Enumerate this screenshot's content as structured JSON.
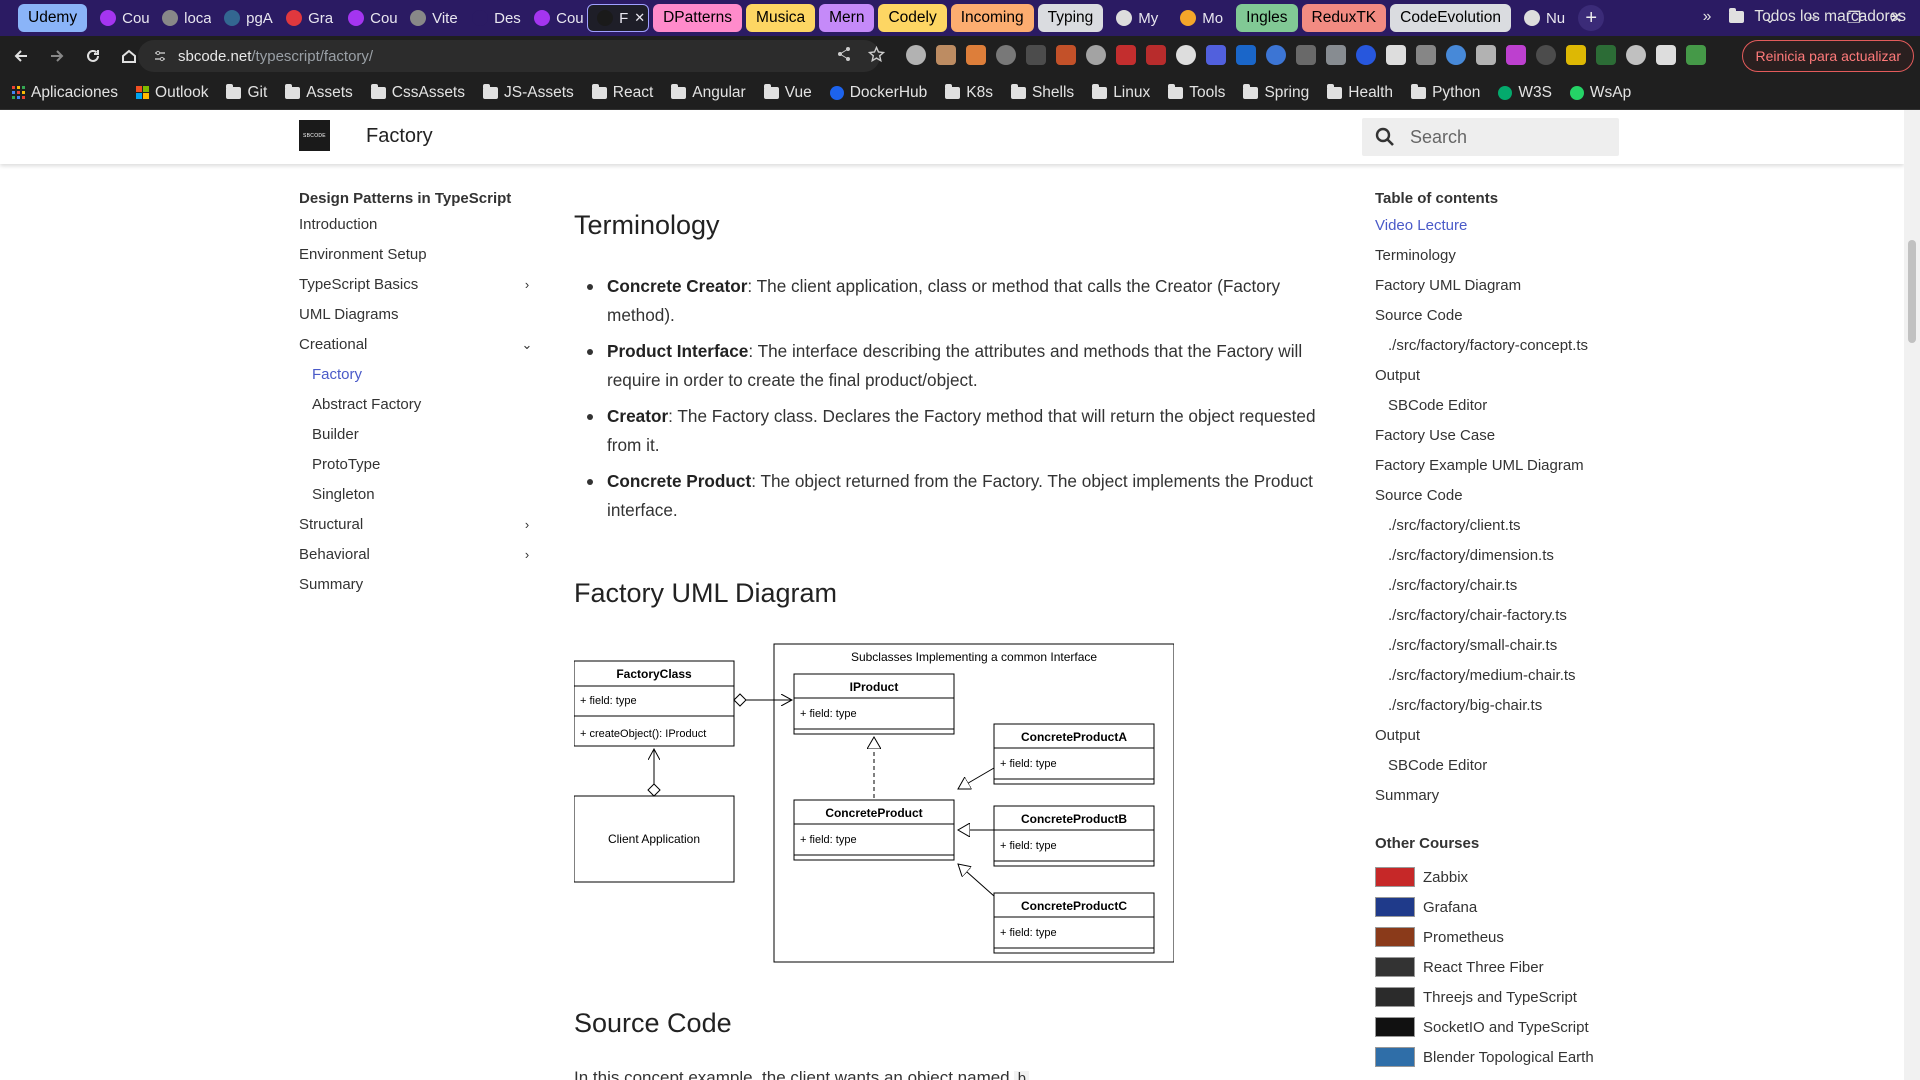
{
  "tabs": [
    {
      "label": "Udemy",
      "type": "group",
      "color": "#8ab4f8"
    },
    {
      "label": "Cou",
      "type": "plain",
      "icon": "udemy-icon",
      "favcolor": "#a435f0"
    },
    {
      "label": "loca",
      "type": "plain",
      "icon": "localhost-icon",
      "favcolor": "#888888"
    },
    {
      "label": "pgA",
      "type": "plain",
      "icon": "pgadmin-icon",
      "favcolor": "#336791"
    },
    {
      "label": "Gra",
      "type": "plain",
      "icon": "grafana-icon",
      "favcolor": "#e0383e"
    },
    {
      "label": "Cou",
      "type": "plain",
      "icon": "udemy-icon",
      "favcolor": "#a435f0"
    },
    {
      "label": "Vite",
      "type": "plain",
      "icon": "vite-icon",
      "favcolor": "#888888"
    },
    {
      "label": "Des",
      "type": "plain",
      "icon": "design-icon",
      "favcolor": "#2b1b63"
    },
    {
      "label": "Cou",
      "type": "plain",
      "icon": "udemy-icon",
      "favcolor": "#a435f0"
    },
    {
      "label": "F",
      "type": "active",
      "icon": "sbcode-icon",
      "favcolor": "#1a1a1a"
    },
    {
      "label": "DPatterns",
      "type": "group",
      "color": "#ff8bcb"
    },
    {
      "label": "Musica",
      "type": "group",
      "color": "#fdd663"
    },
    {
      "label": "Mern",
      "type": "group",
      "color": "#c58af9"
    },
    {
      "label": "Codely",
      "type": "group",
      "color": "#fdd663"
    },
    {
      "label": "Incoming",
      "type": "group",
      "color": "#fcad70"
    },
    {
      "label": "Typing",
      "type": "group",
      "color": "#dadce0"
    },
    {
      "label": "My",
      "type": "chip",
      "icon": "doc-icon",
      "favcolor": "#dddddd"
    },
    {
      "label": "Mo",
      "type": "chip",
      "icon": "mt-icon",
      "favcolor": "#f4a62a"
    },
    {
      "label": "Ingles",
      "type": "group",
      "color": "#81c995"
    },
    {
      "label": "ReduxTK",
      "type": "group",
      "color": "#f28b82"
    },
    {
      "label": "CodeEvolution",
      "type": "group",
      "color": "#dadce0"
    },
    {
      "label": "Nu",
      "type": "chip",
      "icon": "globe-icon",
      "favcolor": "#dddddd"
    }
  ],
  "window": {
    "newtab": "+",
    "minimize": "–",
    "maximize": "❐",
    "close": "✕",
    "tablist": "⌄"
  },
  "address": {
    "host": "sbcode.net",
    "path": "/typescript/factory/",
    "update_label": "Reinicia para actualizar"
  },
  "bookmarks": [
    {
      "label": "Aplicaciones",
      "icon": "apps-grid-icon"
    },
    {
      "label": "Outlook",
      "icon": "microsoft-icon"
    },
    {
      "label": "Git",
      "icon": "folder-icon"
    },
    {
      "label": "Assets",
      "icon": "folder-icon"
    },
    {
      "label": "CssAssets",
      "icon": "folder-icon"
    },
    {
      "label": "JS-Assets",
      "icon": "folder-icon"
    },
    {
      "label": "React",
      "icon": "folder-icon"
    },
    {
      "label": "Angular",
      "icon": "folder-icon"
    },
    {
      "label": "Vue",
      "icon": "folder-icon"
    },
    {
      "label": "DockerHub",
      "icon": "docker-icon"
    },
    {
      "label": "K8s",
      "icon": "folder-icon"
    },
    {
      "label": "Shells",
      "icon": "folder-icon"
    },
    {
      "label": "Linux",
      "icon": "folder-icon"
    },
    {
      "label": "Tools",
      "icon": "folder-icon"
    },
    {
      "label": "Spring",
      "icon": "folder-icon"
    },
    {
      "label": "Health",
      "icon": "folder-icon"
    },
    {
      "label": "Python",
      "icon": "folder-icon"
    },
    {
      "label": "W3S",
      "icon": "w3s-icon"
    },
    {
      "label": "WsAp",
      "icon": "whatsapp-icon"
    }
  ],
  "bookmarks_more": "»",
  "bookmarks_all": "Todos los marcadores",
  "site": {
    "logo_text": "SBCODE",
    "title": "Factory",
    "search_placeholder": "Search"
  },
  "sidebar": {
    "heading": "Design Patterns in TypeScript",
    "items": [
      {
        "label": "Introduction"
      },
      {
        "label": "Environment Setup"
      },
      {
        "label": "TypeScript Basics",
        "chevron": "›"
      },
      {
        "label": "UML Diagrams"
      },
      {
        "label": "Creational",
        "chevron": "⌄"
      },
      {
        "label": "Factory",
        "sub": true,
        "active": true
      },
      {
        "label": "Abstract Factory",
        "sub": true
      },
      {
        "label": "Builder",
        "sub": true
      },
      {
        "label": "ProtoType",
        "sub": true
      },
      {
        "label": "Singleton",
        "sub": true
      },
      {
        "label": "Structural",
        "chevron": "›"
      },
      {
        "label": "Behavioral",
        "chevron": "›"
      },
      {
        "label": "Summary"
      }
    ]
  },
  "content": {
    "h_terminology": "Terminology",
    "terms": [
      {
        "term": "Concrete Creator",
        "desc": ": The client application, class or method that calls the Creator (Factory method)."
      },
      {
        "term": "Product Interface",
        "desc": ": The interface describing the attributes and methods that the Factory will require in order to create the final product/object."
      },
      {
        "term": "Creator",
        "desc": ": The Factory class. Declares the Factory method that will return the object requested from it."
      },
      {
        "term": "Concrete Product",
        "desc": ": The object returned from the Factory. The object implements the Product interface."
      }
    ],
    "h_uml": "Factory UML Diagram",
    "h_source": "Source Code",
    "intro": "In this concept example, the client wants an object named",
    "intro_code": "b"
  },
  "uml": {
    "factory_class": "FactoryClass",
    "field": "+ field: type",
    "method": "+ createObject(): IProduct",
    "client": "Client Application",
    "group_title": "Subclasses Implementing a common Interface",
    "iproduct": "IProduct",
    "concrete_product": "ConcreteProduct",
    "cpa": "ConcreteProductA",
    "cpb": "ConcreteProductB",
    "cpc": "ConcreteProductC"
  },
  "toc": {
    "heading": "Table of contents",
    "items": [
      {
        "label": "Video Lecture",
        "active": true
      },
      {
        "label": "Terminology"
      },
      {
        "label": "Factory UML Diagram"
      },
      {
        "label": "Source Code"
      },
      {
        "label": "./src/factory/factory-concept.ts",
        "sub": true
      },
      {
        "label": "Output"
      },
      {
        "label": "SBCode Editor",
        "sub": true
      },
      {
        "label": "Factory Use Case"
      },
      {
        "label": "Factory Example UML Diagram"
      },
      {
        "label": "Source Code"
      },
      {
        "label": "./src/factory/client.ts",
        "sub": true
      },
      {
        "label": "./src/factory/dimension.ts",
        "sub": true
      },
      {
        "label": "./src/factory/chair.ts",
        "sub": true
      },
      {
        "label": "./src/factory/chair-factory.ts",
        "sub": true
      },
      {
        "label": "./src/factory/small-chair.ts",
        "sub": true
      },
      {
        "label": "./src/factory/medium-chair.ts",
        "sub": true
      },
      {
        "label": "./src/factory/big-chair.ts",
        "sub": true
      },
      {
        "label": "Output"
      },
      {
        "label": "SBCode Editor",
        "sub": true
      },
      {
        "label": "Summary"
      }
    ],
    "courses_heading": "Other Courses",
    "courses": [
      {
        "label": "Zabbix",
        "color": "#c62828"
      },
      {
        "label": "Grafana",
        "color": "#1f3a8a"
      },
      {
        "label": "Prometheus",
        "color": "#8a3a1a"
      },
      {
        "label": "React Three Fiber",
        "color": "#333333"
      },
      {
        "label": "Threejs and TypeScript",
        "color": "#2b2b2b"
      },
      {
        "label": "SocketIO and TypeScript",
        "color": "#111111"
      },
      {
        "label": "Blender Topological Earth",
        "color": "#2f6ea8"
      }
    ]
  }
}
